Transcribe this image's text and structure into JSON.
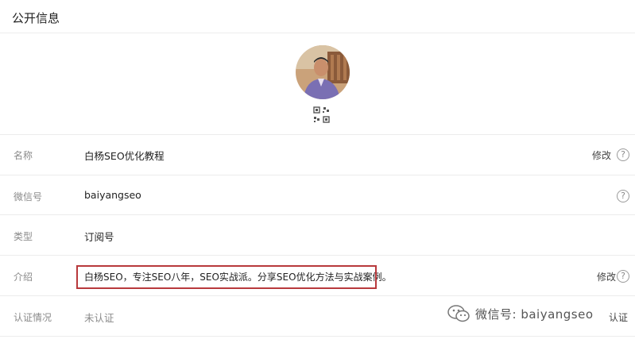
{
  "page": {
    "section_title": "公开信息"
  },
  "profile": {
    "avatar_alt": "头像",
    "qr_icon": "qr-code-icon"
  },
  "rows": [
    {
      "label": "名称",
      "value": "白杨SEO优化教程",
      "action": "修改",
      "help": "?"
    },
    {
      "label": "微信号",
      "value": "baiyangseo",
      "help": "?"
    },
    {
      "label": "类型",
      "value": "订阅号"
    },
    {
      "label": "介绍",
      "value": "白杨SEO，专注SEO八年，SEO实战派。分享SEO优化方法与实战案例。",
      "action": "修改",
      "help": "?"
    },
    {
      "label": "认证情况",
      "value": "未认证",
      "action": "认证"
    }
  ],
  "watermark": {
    "text": "微信号: baiyangseo",
    "icon": "wechat-logo-icon"
  },
  "colors": {
    "highlight": "#b8393c",
    "label": "#8a8a8a",
    "rule": "#ececec"
  }
}
